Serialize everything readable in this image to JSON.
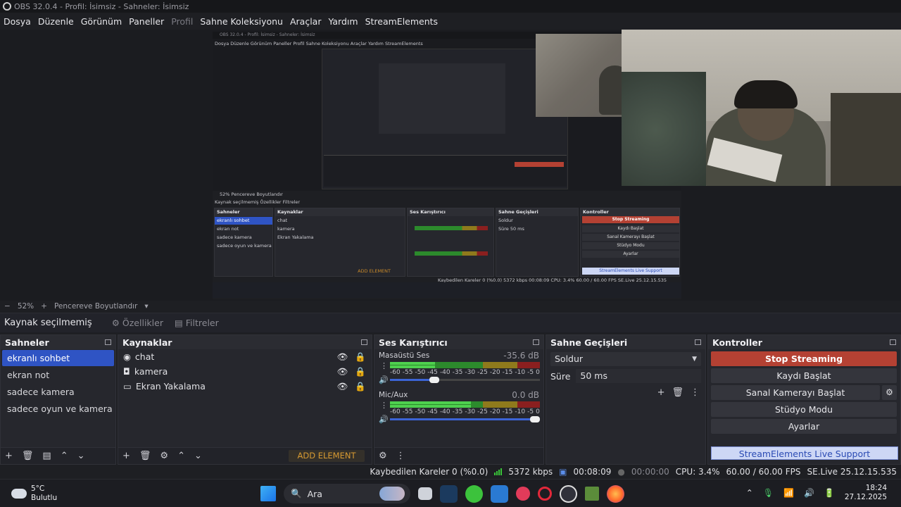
{
  "window": {
    "title": "OBS 32.0.4 - Profil: İsimsiz - Sahneler: İsimsiz"
  },
  "menu": [
    "Dosya",
    "Düzenle",
    "Görünüm",
    "Paneller",
    "Profil",
    "Sahne Koleksiyonu",
    "Araçlar",
    "Yardım",
    "StreamElements"
  ],
  "preview": {
    "nested": {
      "title": "OBS 32.0.4 - Profil: İsimsiz - Sahneler: İsimsiz",
      "menu": "Dosya  Düzenle  Görünüm  Paneller  Profil  Sahne Koleksiyonu  Araçlar  Yardım  StreamElements",
      "zoom_line": "52%  Pencereve Boyutlandır",
      "source_line": "Kaynak seçilmemiş     Özellikler   Filtreler",
      "panels": {
        "scenes": "Sahneler",
        "sources": "Kaynaklar",
        "mixer": "Ses Karıştırıcı",
        "transitions": "Sahne Geçişleri",
        "controls": "Kontroller"
      },
      "scenes": [
        "ekranlı sohbet",
        "ekran not",
        "sadece kamera",
        "sadece oyun ve kamera"
      ],
      "sources": [
        "chat",
        "kamera",
        "Ekran Yakalama"
      ],
      "stop": "Stop Streaming",
      "buttons": [
        "Kaydı Başlat",
        "Sanal Kamerayı Başlat",
        "Stüdyo Modu",
        "Ayarlar"
      ],
      "status": "Kaybedilen Kareler 0 (%0.0)   5372 kbps   00:08:09   CPU: 3.4%  60.00 / 60.00 FPS   SE.Live 25.12.15.535",
      "add_element": "ADD ELEMENT",
      "se_support": "StreamElements Live Support",
      "trans_select": "Soldur",
      "trans_duration": "Süre   50 ms"
    }
  },
  "zoom": {
    "percent": "52%",
    "fit_label": "Pencereve Boyutlandır"
  },
  "source_bar": {
    "label": "Kaynak seçilmemiş",
    "properties": "Özellikler",
    "filters": "Filtreler"
  },
  "scenes": {
    "title": "Sahneler",
    "items": [
      "ekranlı sohbet",
      "ekran not",
      "sadece kamera",
      "sadece oyun ve kamera"
    ],
    "active_index": 0
  },
  "sources": {
    "title": "Kaynaklar",
    "items": [
      {
        "name": "chat",
        "icon": "globe-icon"
      },
      {
        "name": "kamera",
        "icon": "camera-icon"
      },
      {
        "name": "Ekran Yakalama",
        "icon": "monitor-icon"
      }
    ],
    "add_element": "ADD ELEMENT"
  },
  "mixer": {
    "title": "Ses Karıştırıcı",
    "ticks": [
      "-60",
      "-55",
      "-50",
      "-45",
      "-40",
      "-35",
      "-30",
      "-25",
      "-20",
      "-15",
      "-10",
      "-5",
      "0"
    ],
    "tracks": [
      {
        "name": "Masaüstü Ses",
        "db": "-35.6 dB",
        "level": 0.3,
        "volume": 0.33
      },
      {
        "name": "Mic/Aux",
        "db": "0.0 dB",
        "level": 0.54,
        "volume": 1.0
      }
    ]
  },
  "transitions": {
    "title": "Sahne Geçişleri",
    "selected": "Soldur",
    "duration_label": "Süre",
    "duration_value": "50 ms"
  },
  "controls": {
    "title": "Kontroller",
    "stop": "Stop Streaming",
    "record": "Kaydı Başlat",
    "virtual_cam": "Sanal Kamerayı Başlat",
    "studio": "Stüdyo Modu",
    "settings": "Ayarlar",
    "support": "StreamElements Live Support"
  },
  "status": {
    "dropped": "Kaybedilen Kareler 0 (%0.0)",
    "bitrate": "5372 kbps",
    "stream_time": "00:08:09",
    "rec_time": "00:00:00",
    "cpu": "CPU: 3.4%",
    "fps": "60.00 / 60.00 FPS",
    "version": "SE.Live 25.12.15.535"
  },
  "taskbar": {
    "weather_temp": "5°C",
    "weather_desc": "Bulutlu",
    "search": "Ara",
    "time": "18:24",
    "date": "27.12.2025"
  },
  "colors": {
    "accent": "#2f54c4",
    "stop": "#b44133",
    "add_element": "#d79a32"
  }
}
